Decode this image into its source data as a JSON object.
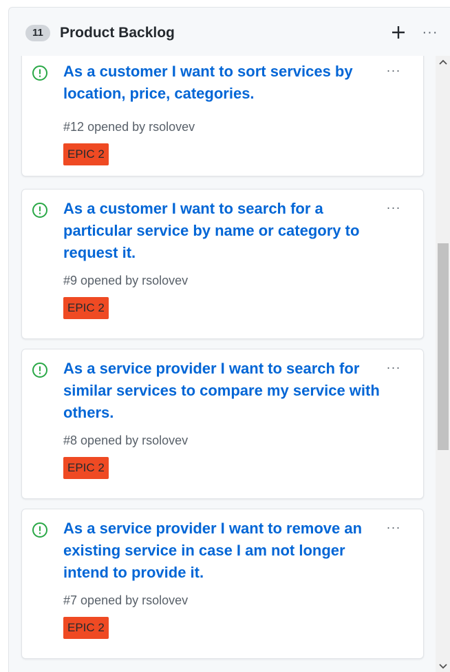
{
  "column": {
    "count": "11",
    "title": "Product Backlog"
  },
  "colors": {
    "link": "#0366d6",
    "open_issue": "#28a745",
    "epic_label": "#ef4a23"
  },
  "cards": [
    {
      "title": "As a customer I want to sort services by location, price, categories.",
      "number": "#12",
      "opened_by_text": "opened by",
      "author": "rsolovev",
      "label": "EPIC 2",
      "icon": "open-issue-icon"
    },
    {
      "title": "As a customer I want to search for a particular service by name or category to request it.",
      "number": "#9",
      "opened_by_text": "opened by",
      "author": "rsolovev",
      "label": "EPIC 2",
      "icon": "open-issue-icon"
    },
    {
      "title": "As a service provider I want to search for similar services to compare my service with others.",
      "number": "#8",
      "opened_by_text": "opened by",
      "author": "rsolovev",
      "label": "EPIC 2",
      "icon": "open-issue-icon"
    },
    {
      "title": "As a service provider I want to remove an existing service in case I am not longer intend to provide it.",
      "number": "#7",
      "opened_by_text": "opened by",
      "author": "rsolovev",
      "label": "EPIC 2",
      "icon": "open-issue-icon"
    }
  ]
}
